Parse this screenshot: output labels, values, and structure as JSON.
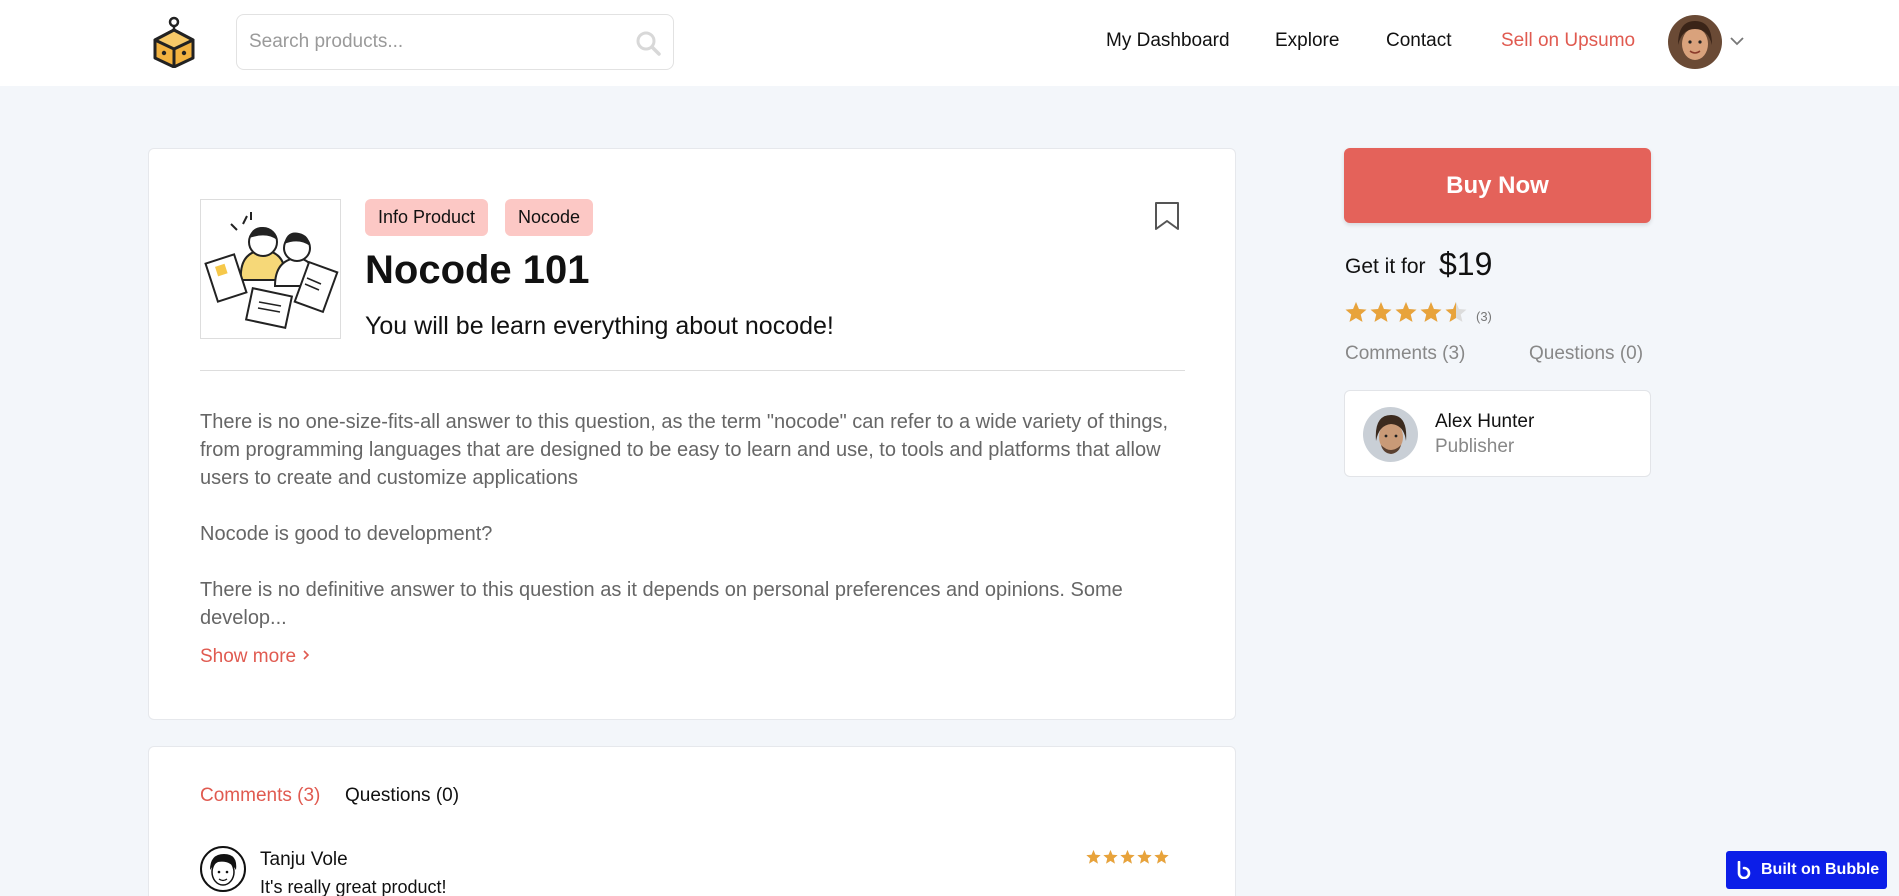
{
  "header": {
    "search_placeholder": "Search products...",
    "nav": [
      "My Dashboard",
      "Explore",
      "Contact",
      "Sell on Upsumo"
    ]
  },
  "product": {
    "tags": [
      "Info Product",
      "Nocode"
    ],
    "title": "Nocode 101",
    "subtitle": "You will be learn everything about nocode!",
    "description": [
      "There is no one-size-fits-all answer to this question, as the term \"nocode\" can refer to a wide variety of things, from programming languages that are designed to be easy to learn and use, to tools and platforms that allow users to create and customize applications",
      "Nocode is good to development?",
      "There is no definitive answer to this question as it depends on personal preferences and opinions. Some develop..."
    ],
    "show_more": "Show more",
    "show_more_icon": "chevron-right-icon"
  },
  "comments_section": {
    "tabs": [
      "Comments (3)",
      "Questions (0)"
    ],
    "comments": [
      {
        "name": "Tanju Vole",
        "text": "It's really great product!",
        "rating": 5
      }
    ]
  },
  "sidebar": {
    "buy_label": "Buy Now",
    "get_it_for": "Get it for",
    "price": "$19",
    "rating": 4.5,
    "rating_count": "(3)",
    "tabs": [
      "Comments (3)",
      "Questions (0)"
    ],
    "publisher": {
      "name": "Alex Hunter",
      "role": "Publisher"
    }
  },
  "badge": {
    "label": "Built on Bubble"
  },
  "colors": {
    "accent": "#e05a50",
    "buy_button": "#e4625a",
    "tag_bg": "#fcc8c5",
    "star": "#e8a33b",
    "background": "#f3f6fa",
    "bubble": "#0c1ee8"
  }
}
